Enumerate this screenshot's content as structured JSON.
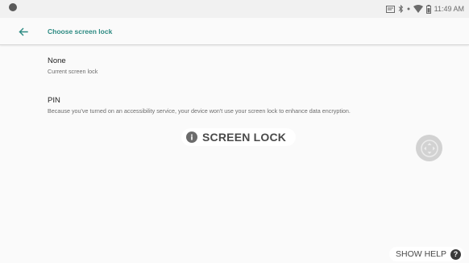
{
  "status_bar": {
    "time": "11:49 AM",
    "icons": [
      "cast-icon",
      "bluetooth-icon",
      "dot-icon",
      "wifi-icon",
      "battery-icon"
    ]
  },
  "app_bar": {
    "title": "Choose screen lock",
    "back_icon": "arrow-left-icon",
    "accent_color": "#2c8a82"
  },
  "options": [
    {
      "title": "None",
      "summary": "Current screen lock"
    },
    {
      "title": "PIN",
      "summary": "Because you've turned on an accessibility service, your device won't use your screen lock to enhance data encryption."
    }
  ],
  "overlay": {
    "label": "SCREEN LOCK",
    "icon": "info-icon"
  },
  "floating_button": {
    "icon": "assistive-touch-icon"
  },
  "help": {
    "label": "SHOW HELP",
    "icon": "question-icon",
    "glyph": "?"
  }
}
